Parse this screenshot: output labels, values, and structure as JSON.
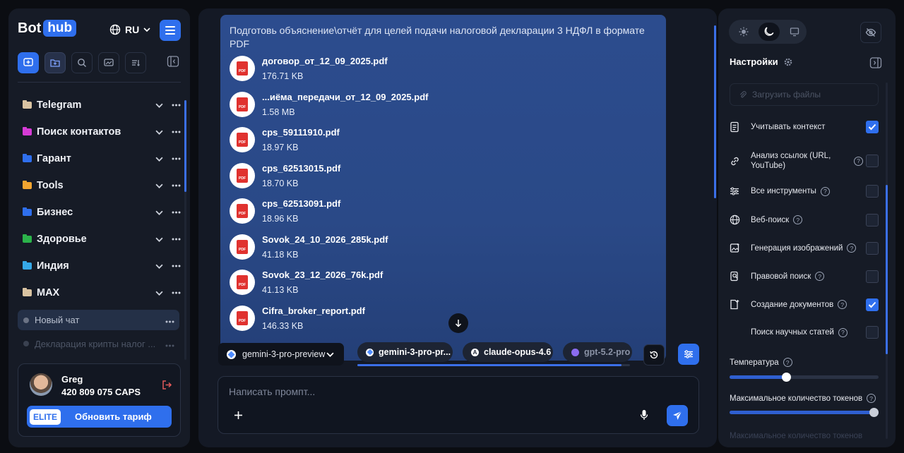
{
  "sidebar": {
    "logo_bot": "Bot",
    "logo_hub": "hub",
    "language": "RU",
    "folders": [
      {
        "label": "Telegram",
        "color": "#d9c3a2"
      },
      {
        "label": "Поиск контактов",
        "color": "#d63bd6"
      },
      {
        "label": "Гарант",
        "color": "#2f6fed"
      },
      {
        "label": "Tools",
        "color": "#f2a530"
      },
      {
        "label": "Бизнес",
        "color": "#2f6fed"
      },
      {
        "label": "Здоровье",
        "color": "#2bb34a"
      },
      {
        "label": "Индия",
        "color": "#36a9e8"
      },
      {
        "label": "MAX",
        "color": "#d9c3a2"
      }
    ],
    "chats": [
      {
        "label": "Новый чат"
      },
      {
        "label": "Декларация крипты налог ..."
      }
    ],
    "user": {
      "name": "Greg",
      "credits": "420 809 075 CAPS",
      "plan_badge": "ELITE",
      "upgrade_label": "Обновить тариф"
    }
  },
  "message": {
    "prompt": "Подготовь объяснение\\отчёт для целей подачи налоговой декларации 3 НДФЛ в формате PDF",
    "pdf_label": "PDF",
    "files": [
      {
        "name": "договор_от_12_09_2025.pdf",
        "size": "176.71 KB"
      },
      {
        "name": "...иёма_передачи_от_12_09_2025.pdf",
        "size": "1.58 MB"
      },
      {
        "name": "cps_59111910.pdf",
        "size": "18.97 KB"
      },
      {
        "name": "cps_62513015.pdf",
        "size": "18.70 KB"
      },
      {
        "name": "cps_62513091.pdf",
        "size": "18.96 KB"
      },
      {
        "name": "Sovok_24_10_2026_285k.pdf",
        "size": "41.18 KB"
      },
      {
        "name": "Sovok_23_12_2026_76k.pdf",
        "size": "41.13 KB"
      },
      {
        "name": "Cifra_broker_report.pdf",
        "size": "146.33 KB"
      }
    ]
  },
  "models": {
    "selected": "gemini-3-pro-preview",
    "chips": [
      {
        "label": "gemini-3-pro-pr...",
        "color": "#4f8cff"
      },
      {
        "label": "claude-opus-4.6",
        "color": "#ffffff"
      },
      {
        "label": "gpt-5.2-pro",
        "color": "#8b6cf0"
      }
    ],
    "scroll_progress": 0.97
  },
  "composer": {
    "placeholder": "Написать промпт..."
  },
  "settings": {
    "title": "Настройки",
    "upload_label": "Загрузить файлы",
    "options": [
      {
        "label": "Учитывать контекст",
        "help": false,
        "checked": true,
        "icon": "document-icon"
      },
      {
        "label": "Анализ ссылок (URL, YouTube)",
        "help": true,
        "checked": false,
        "icon": "link-icon"
      },
      {
        "label": "Все инструменты",
        "help": true,
        "checked": false,
        "icon": "sliders-icon"
      },
      {
        "label": "Веб-поиск",
        "help": true,
        "checked": false,
        "icon": "globe-icon"
      },
      {
        "label": "Генерация изображений",
        "help": true,
        "checked": false,
        "icon": "image-icon"
      },
      {
        "label": "Правовой поиск",
        "help": true,
        "checked": false,
        "icon": "law-search-icon"
      },
      {
        "label": "Создание документов",
        "help": true,
        "checked": true,
        "icon": "new-document-icon"
      },
      {
        "label": "Поиск научных статей",
        "help": true,
        "checked": false,
        "icon": "none"
      }
    ],
    "temperature_label": "Температура",
    "temperature_level": 0.38,
    "max_tokens_label": "Максимальное количество токенов",
    "max_tokens_level": 1.0,
    "faded_label": "Максимальное количество токенов"
  },
  "help_glyph": "?",
  "colors": {
    "accent": "#2f6fed",
    "danger": "#e25a5a"
  }
}
